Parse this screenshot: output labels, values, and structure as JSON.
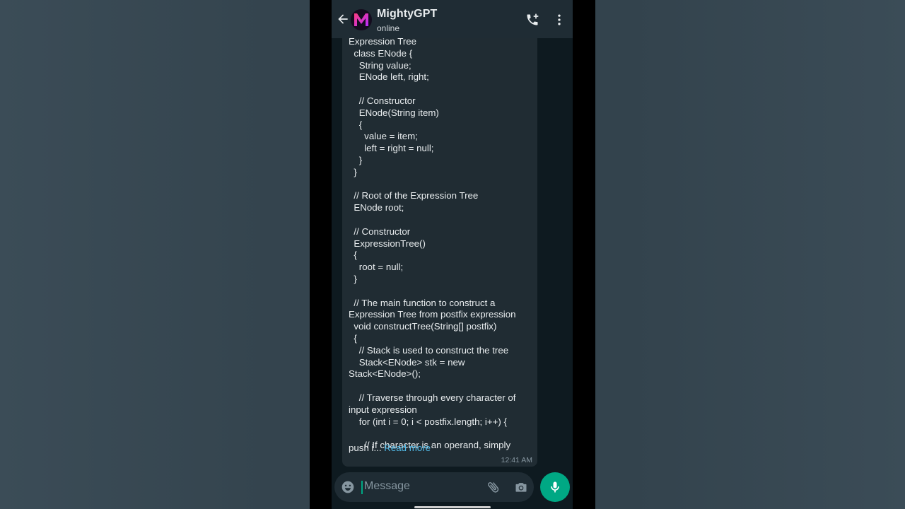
{
  "header": {
    "title": "MightyGPT",
    "status": "online",
    "avatar_letter": "M",
    "icons": [
      "back-arrow-icon",
      "add-call-icon",
      "more-options-icon"
    ]
  },
  "message": {
    "body": "Expression Tree\n  class ENode {\n    String value;\n    ENode left, right;\n\n    // Constructor\n    ENode(String item)\n    {\n      value = item;\n      left = right = null;\n    }\n  }\n\n  // Root of the Expression Tree\n  ENode root;\n\n  // Constructor\n  ExpressionTree()\n  {\n    root = null;\n  }\n\n  // The main function to construct a\nExpression Tree from postfix expression\n  void constructTree(String[] postfix)\n  {\n    // Stack is used to construct the tree\n    Stack<ENode> stk = new\nStack<ENode>();\n\n    // Traverse through every character of\ninput expression\n    for (int i = 0; i < postfix.length; i++) {\n\n      // If character is an operand, simply",
    "tail_prefix": "push i... ",
    "read_more": "Read more",
    "time": "12:41 AM"
  },
  "composer": {
    "placeholder": "Message",
    "icons": [
      "emoji-icon",
      "attach-icon",
      "camera-icon",
      "mic-icon"
    ]
  },
  "colors": {
    "accent": "#00a884",
    "link": "#53bdeb",
    "header_bg": "#1f2c34",
    "bubble_bg": "#202c33"
  }
}
